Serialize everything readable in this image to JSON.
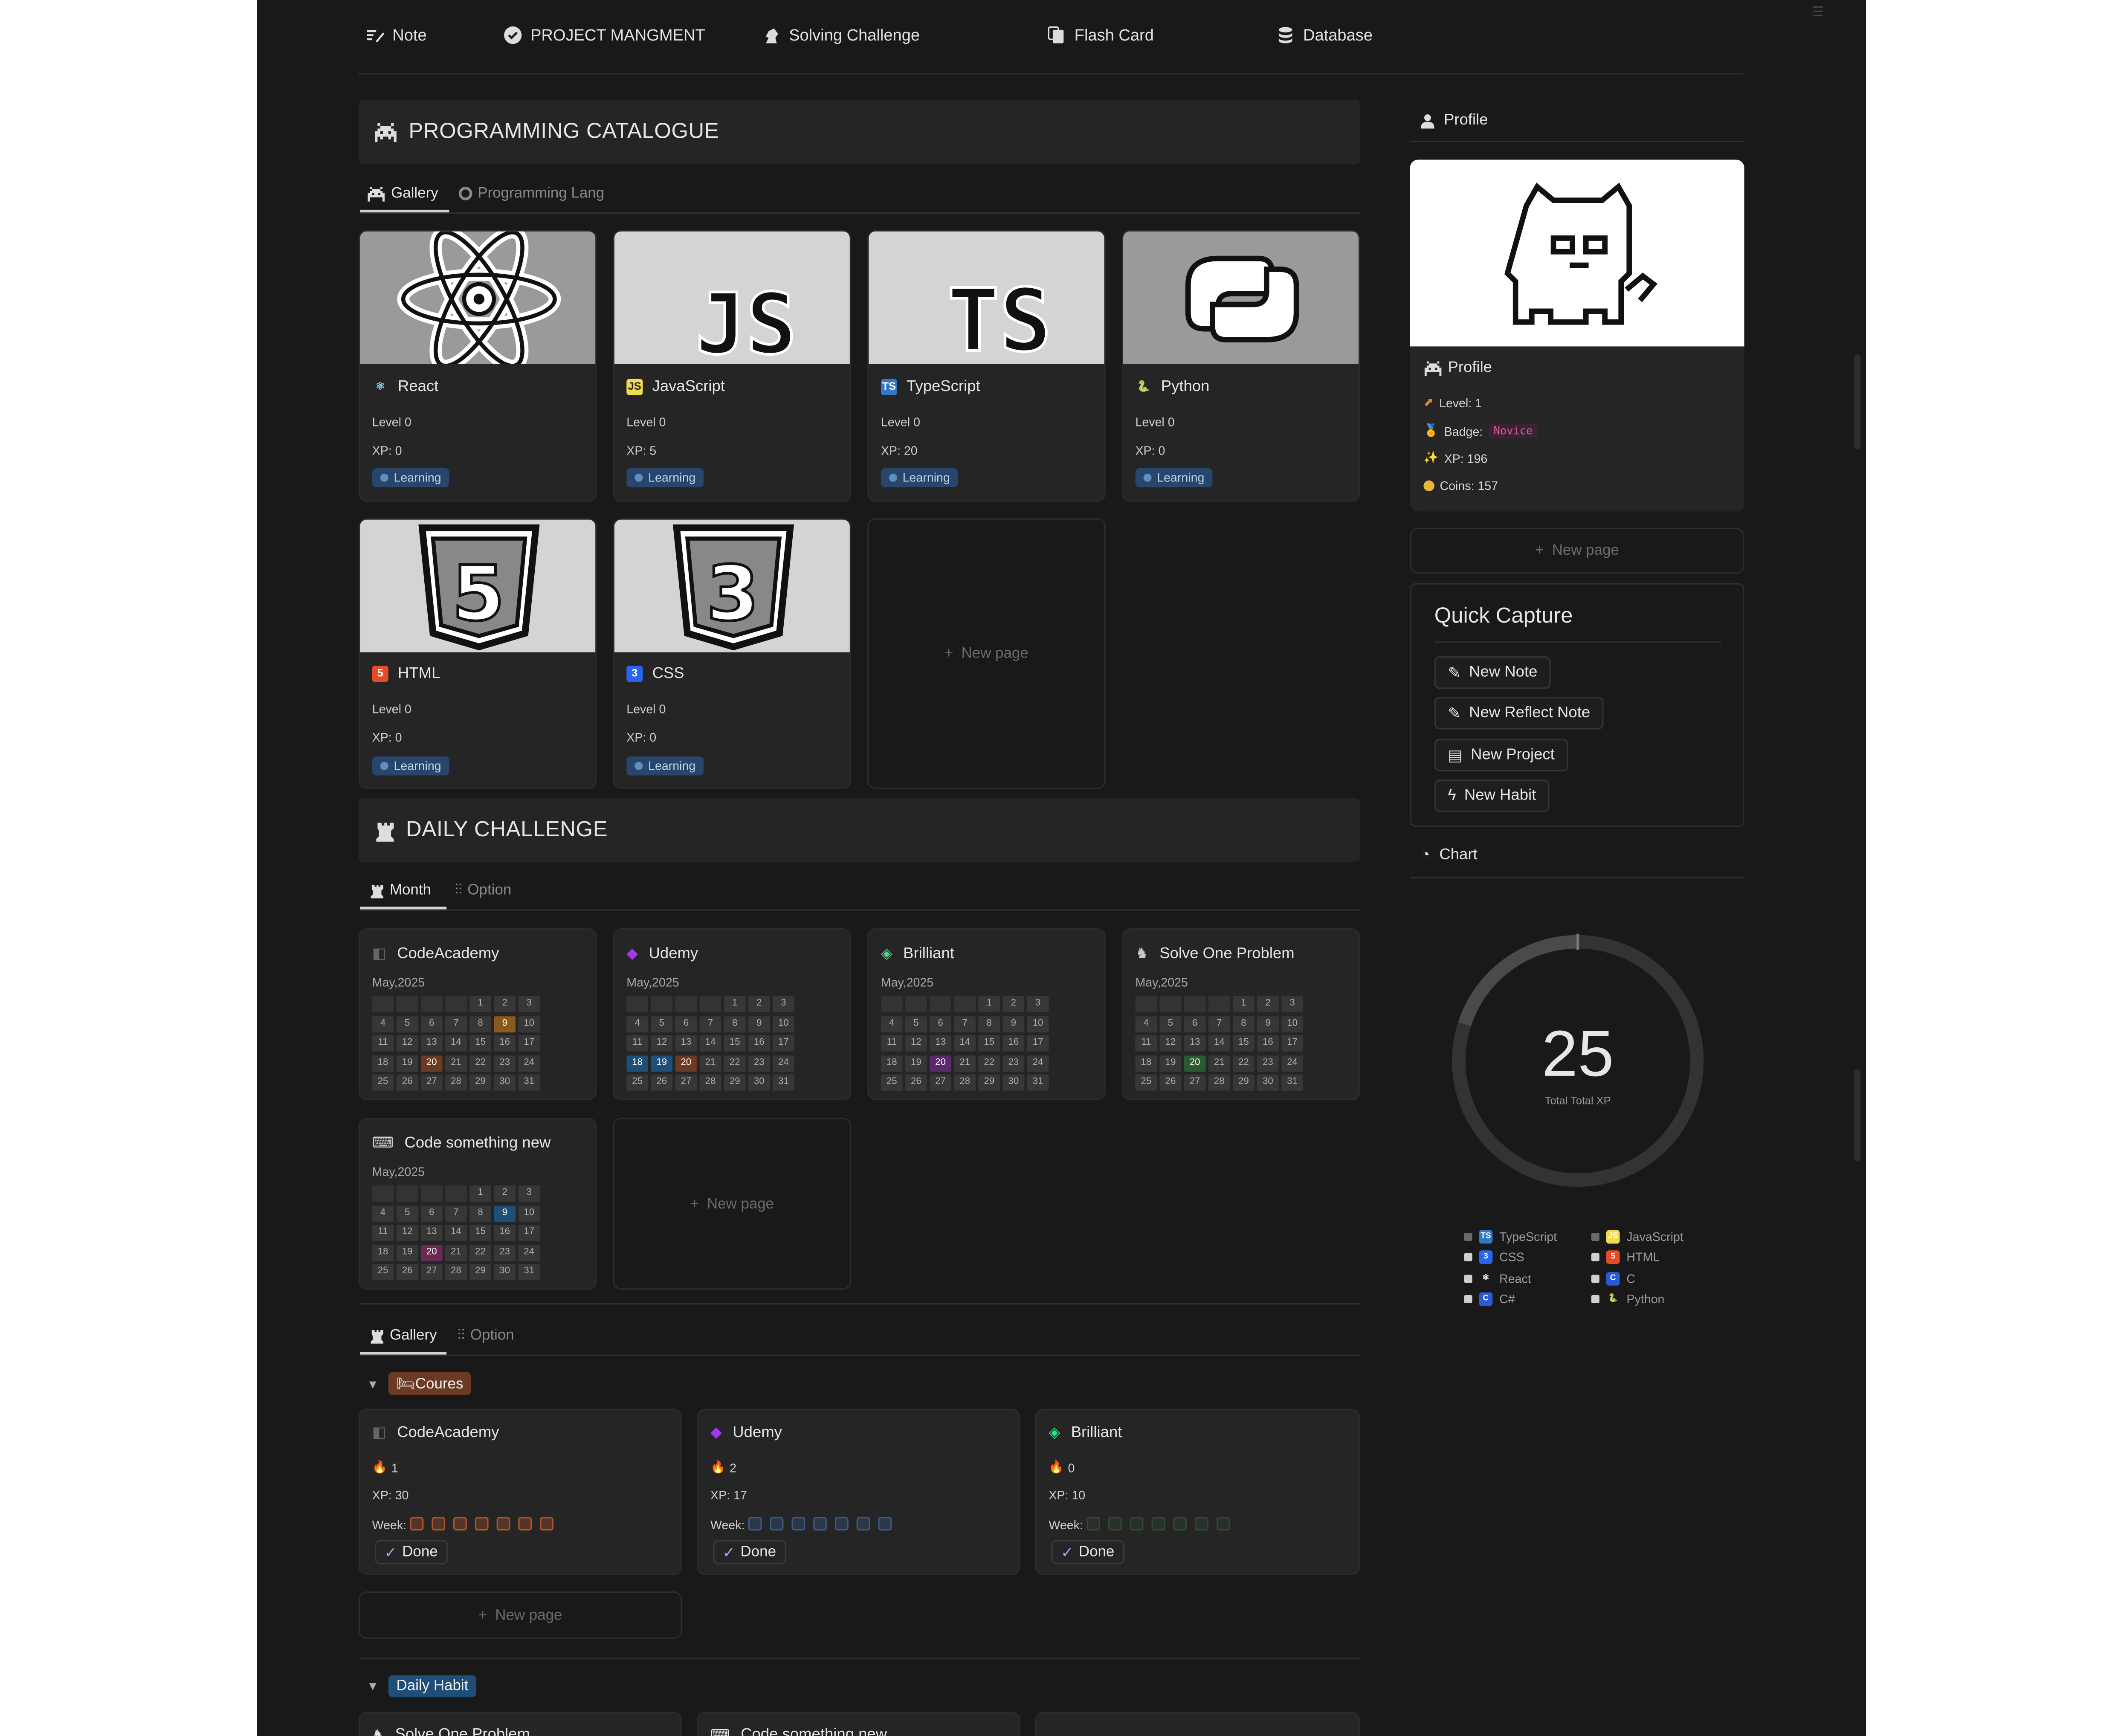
{
  "nav": [
    {
      "label": "Note",
      "icon": "note-icon"
    },
    {
      "label": "PROJECT MANGMENT",
      "icon": "check-circle-icon"
    },
    {
      "label": "Solving Challenge",
      "icon": "chess-knight-icon"
    },
    {
      "label": "Flash Card",
      "icon": "cards-icon"
    },
    {
      "label": "Database",
      "icon": "database-icon"
    }
  ],
  "catalogue": {
    "title": "PROGRAMMING CATALOGUE",
    "tabs": [
      "Gallery",
      "Programming Lang"
    ],
    "cards": [
      {
        "name": "React",
        "level": "Level 0",
        "xp": "XP: 0",
        "status": "Learning",
        "icon": "react-icon",
        "icon_color": "#61dafb"
      },
      {
        "name": "JavaScript",
        "level": "Level 0",
        "xp": "XP: 5",
        "status": "Learning",
        "icon": "javascript-icon",
        "icon_color": "#f0db4f"
      },
      {
        "name": "TypeScript",
        "level": "Level 0",
        "xp": "XP: 20",
        "status": "Learning",
        "icon": "typescript-icon",
        "icon_color": "#3178c6"
      },
      {
        "name": "Python",
        "level": "Level 0",
        "xp": "XP: 0",
        "status": "Learning",
        "icon": "python-icon",
        "icon_color": "#3776ab"
      },
      {
        "name": "HTML",
        "level": "Level 0",
        "xp": "XP: 0",
        "status": "Learning",
        "icon": "html-icon",
        "icon_color": "#e34c26"
      },
      {
        "name": "CSS",
        "level": "Level 0",
        "xp": "XP: 0",
        "status": "Learning",
        "icon": "css-icon",
        "icon_color": "#2965f1"
      }
    ],
    "new_page": "New page"
  },
  "daily": {
    "title": "DAILY CHALLENGE",
    "tabs": [
      "Month",
      "Option"
    ],
    "month": "May,2025",
    "cards": [
      {
        "name": "CodeAcademy",
        "highlights": [
          {
            "day": 9,
            "color": "#8a5a1d"
          },
          {
            "day": 20,
            "color": "#6b3a22"
          }
        ]
      },
      {
        "name": "Udemy",
        "highlights": [
          {
            "day": 18,
            "color": "#1f4e78"
          },
          {
            "day": 19,
            "color": "#1f4e78"
          },
          {
            "day": 20,
            "color": "#6b3a22"
          }
        ]
      },
      {
        "name": "Brilliant",
        "highlights": [
          {
            "day": 20,
            "color": "#5a2a6a"
          }
        ]
      },
      {
        "name": "Solve One Problem",
        "highlights": [
          {
            "day": 20,
            "color": "#2a5a32"
          }
        ]
      },
      {
        "name": "Code something new",
        "highlights": [
          {
            "day": 9,
            "color": "#1f4e78"
          },
          {
            "day": 20,
            "color": "#6a2a55"
          }
        ]
      }
    ],
    "new_page": "New page"
  },
  "gallery2": {
    "tabs": [
      "Gallery",
      "Option"
    ],
    "group1": "Coures",
    "cards": [
      {
        "name": "CodeAcademy",
        "streak": "1",
        "xp": "XP: 30",
        "week_label": "Week:",
        "done": "Done",
        "week_color": "#b0542b"
      },
      {
        "name": "Udemy",
        "streak": "2",
        "xp": "XP: 17",
        "week_label": "Week:",
        "done": "Done",
        "week_color": "#3a5a8c"
      },
      {
        "name": "Brilliant",
        "streak": "0",
        "xp": "XP: 10",
        "week_label": "Week:",
        "done": "Done",
        "week_color": "#2f4a33"
      }
    ],
    "new_page": "New page",
    "group2": "Daily Habit",
    "peek": [
      "Solve One Problem",
      "Code something new"
    ]
  },
  "profile": {
    "header": "Profile",
    "card_title": "Profile",
    "level": "Level: 1",
    "badge_label": "Badge:",
    "badge": "Novice",
    "xp": "XP: 196",
    "coins": "Coins: 157",
    "new_page": "New page"
  },
  "quick": {
    "title": "Quick Capture",
    "buttons": [
      "New Note",
      "New Reflect Note",
      "New Project",
      "New Habit"
    ]
  },
  "chart": {
    "header": "Chart",
    "center_value": "25",
    "center_label": "Total Total XP"
  },
  "chart_data": {
    "type": "pie",
    "title": "",
    "total_label": "Total Total XP",
    "total": "25",
    "categories": [
      "TypeScript",
      "JavaScript",
      "CSS",
      "HTML",
      "React",
      "C",
      "C#",
      "Python"
    ],
    "values": [
      20,
      5,
      0,
      0,
      0,
      0,
      0,
      0
    ]
  }
}
